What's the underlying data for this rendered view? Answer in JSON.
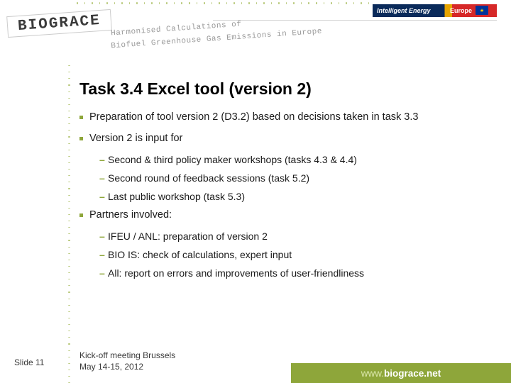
{
  "header": {
    "logo": "BIOGRACE",
    "tagline1": "Harmonised Calculations of",
    "tagline2": "Biofuel Greenhouse Gas Emissions in Europe",
    "ie_badge": "Intelligent Energy",
    "ie_europe": "Europe"
  },
  "slide": {
    "title": "Task 3.4 Excel tool (version 2)",
    "bullets": [
      {
        "text": "Preparation of tool version 2 (D3.2) based on decisions taken in task 3.3"
      },
      {
        "text": "Version 2 is input for",
        "sub": [
          "Second & third policy maker workshops (tasks 4.3 & 4.4)",
          "Second round of feedback sessions (task 5.2)",
          "Last public workshop (task 5.3)"
        ]
      },
      {
        "text": "Partners involved:",
        "sub": [
          "IFEU / ANL: preparation of version 2",
          "BIO IS: check of calculations, expert input",
          "All: report on errors and improvements of user-friendliness"
        ]
      }
    ]
  },
  "footer": {
    "slide_num": "Slide 11",
    "meeting_l1": "Kick-off meeting Brussels",
    "meeting_l2": "May 14-15, 2012",
    "url_prefix": "www.",
    "url_main": "biograce.net"
  }
}
